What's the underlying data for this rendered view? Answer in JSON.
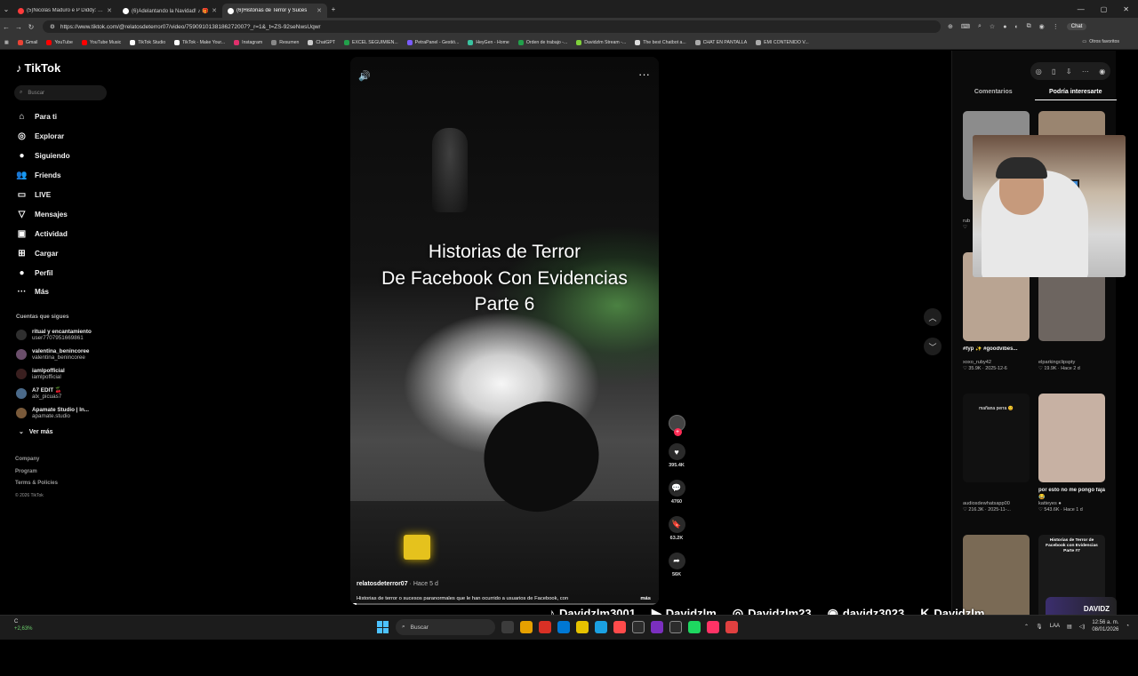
{
  "browser": {
    "tabs": [
      {
        "title": "(5)Nicolás Maduro e P Diddy: Um ",
        "active": false,
        "color": "#ff3b3b"
      },
      {
        "title": "(6)Adelantando la Navidad! ♪ 🎁",
        "active": false,
        "color": "#ffffff"
      },
      {
        "title": "(6)Historias de Terror y Suces",
        "active": true,
        "color": "#ffffff"
      }
    ],
    "url": "https://www.tiktok.com/@relatosdeterror07/video/7590910138186272007?_r=1&_t=ZS-92seNwsUqwr",
    "chat_label": "Chat",
    "bookmarks": [
      {
        "label": "Gmail",
        "color": "#ea4335"
      },
      {
        "label": "YouTube",
        "color": "#ff0000"
      },
      {
        "label": "YouTube Music",
        "color": "#ff0000"
      },
      {
        "label": "TikTok Studio",
        "color": "#ffffff"
      },
      {
        "label": "TikTok - Make Your...",
        "color": "#ffffff"
      },
      {
        "label": "Instagram",
        "color": "#e1306c"
      },
      {
        "label": "Resumen",
        "color": "#888888"
      },
      {
        "label": "ChatGPT",
        "color": "#cccccc"
      },
      {
        "label": "EXCEL SEGUIMIEN...",
        "color": "#22a04b"
      },
      {
        "label": "PetraPanel - Gestió...",
        "color": "#7a5cff"
      },
      {
        "label": "HeyGen - Home",
        "color": "#3ac3a0"
      },
      {
        "label": "Orden de trabajo -...",
        "color": "#22a04b"
      },
      {
        "label": "Davidzlm Stream -...",
        "color": "#7fd13b"
      },
      {
        "label": "The best Chatbot a...",
        "color": "#dddddd"
      },
      {
        "label": "CHAT EN PANTALLA",
        "color": "#aaaaaa"
      },
      {
        "label": "EMI CONTENIDO V...",
        "color": "#aaaaaa"
      }
    ],
    "other_bookmarks": "Otros favoritos"
  },
  "sidebar": {
    "logo": "TikTok",
    "search_placeholder": "Buscar",
    "nav": [
      {
        "label": "Para ti",
        "icon": "home-icon",
        "glyph": "⌂"
      },
      {
        "label": "Explorar",
        "icon": "compass-icon",
        "glyph": "◎"
      },
      {
        "label": "Siguiendo",
        "icon": "following-avatar-icon",
        "glyph": "●"
      },
      {
        "label": "Friends",
        "icon": "friends-icon",
        "glyph": "👥"
      },
      {
        "label": "LIVE",
        "icon": "live-icon",
        "glyph": "▭"
      },
      {
        "label": "Mensajes",
        "icon": "messages-icon",
        "glyph": "▽"
      },
      {
        "label": "Actividad",
        "icon": "activity-icon",
        "glyph": "▣"
      },
      {
        "label": "Cargar",
        "icon": "upload-icon",
        "glyph": "⊞"
      },
      {
        "label": "Perfil",
        "icon": "profile-icon",
        "glyph": "●"
      },
      {
        "label": "Más",
        "icon": "more-icon",
        "glyph": "···"
      }
    ],
    "following_title": "Cuentas que sigues",
    "following": [
      {
        "name": "ritual y encantamiento",
        "user": "user7707951669861"
      },
      {
        "name": "valentina_benincoree",
        "user": "valentina_benincoree"
      },
      {
        "name": "iamlpofficial",
        "user": "iamlpofficial"
      },
      {
        "name": "A7 EDIT 🍒",
        "user": "alx_picuas7"
      },
      {
        "name": "Apamate Studio | In...",
        "user": "apamate.studio"
      }
    ],
    "see_more": "Ver más",
    "footer": [
      "Company",
      "Program",
      "Terms & Policies"
    ],
    "copyright": "© 2026 TikTok"
  },
  "video": {
    "title_lines": [
      "Historias de Terror",
      "De Facebook Con Evidencias",
      "Parte 6"
    ],
    "author": "relatosdeterror07",
    "ago": "· Hace 5 d",
    "description": "Historias de terror o sucesos paranormales que le han ocurrido a usuarios de Facebook, con",
    "more": "más",
    "progress": 0.02
  },
  "actions": [
    {
      "name": "like",
      "icon": "heart-icon",
      "glyph": "♥",
      "count": "395.4K"
    },
    {
      "name": "comment",
      "icon": "comment-icon",
      "glyph": "💬",
      "count": "4760"
    },
    {
      "name": "save",
      "icon": "bookmark-icon",
      "glyph": "🔖",
      "count": "63.2K"
    },
    {
      "name": "share",
      "icon": "share-icon",
      "glyph": "➦",
      "count": "56K"
    }
  ],
  "right_panel": {
    "tabs": [
      "Comentarios",
      "Podría interesarte"
    ],
    "active_tab": 1,
    "cards": [
      {
        "caption": "",
        "user": "rub",
        "meta": "♡",
        "color": "#8c8c8c"
      },
      {
        "caption": "",
        "user": "",
        "meta": "",
        "color": "#9a8570"
      },
      {
        "caption": "#fyp ✨ #goodvibes...",
        "user": "xoxo_ruby42",
        "meta": "♡ 35.9K · 2025-12-6",
        "color": "#b9a492"
      },
      {
        "caption": "",
        "user": "elparkingclipspty",
        "meta": "♡ 19.9K · Hace 2 d",
        "color": "#6d6560"
      },
      {
        "caption": "",
        "user": "audiosdewhatsapp00",
        "meta": "♡ 216.3K · 2025-11-...",
        "color": "#111111"
      },
      {
        "caption": "por esto no me pongo faja 😂",
        "user": "katteyes ●",
        "meta": "♡ 543.6K · Hace 1 d",
        "color": "#c7b1a3"
      },
      {
        "caption": "",
        "user": "",
        "meta": "",
        "color": "#7a6a55"
      },
      {
        "caption": "",
        "user": "",
        "meta": "",
        "color": "#1a1a1a"
      }
    ],
    "card_overlay_a": "mañana perra 😊",
    "card_overlay_b": "Historias de Terror de Facebook con Evidencias Parte #7"
  },
  "stream_overlay": {
    "socials": [
      {
        "platform": "TikTok",
        "icon": "tiktok-icon",
        "glyph": "♪",
        "handle": "Davidzlm3001"
      },
      {
        "platform": "YouTube",
        "icon": "youtube-icon",
        "glyph": "▶",
        "handle": "Davidzlm"
      },
      {
        "platform": "Instagram",
        "icon": "instagram-icon",
        "glyph": "◎",
        "handle": "Davidzlm23"
      },
      {
        "platform": "Discord",
        "icon": "discord-icon",
        "glyph": "◉",
        "handle": "davidz3023"
      },
      {
        "platform": "Kick",
        "icon": "kick-icon",
        "glyph": "K",
        "handle": "Davidzlm"
      }
    ],
    "badge": "DAVIDZ"
  },
  "taskbar": {
    "weather_top": "C",
    "weather_bottom": "+2,63%",
    "search": "Buscar",
    "lang": "LAA",
    "time": "12:56 a. m.",
    "date": "08/01/2026",
    "apps": [
      "#3c3c3c",
      "#e6a000",
      "#d93025",
      "#0078d4",
      "#e6c200",
      "#1ba1e2",
      "#ff4b4b",
      "#ffffff",
      "#7b2fbf",
      "#ffffff",
      "#1ed760",
      "#ff3366",
      "#e04040"
    ]
  }
}
